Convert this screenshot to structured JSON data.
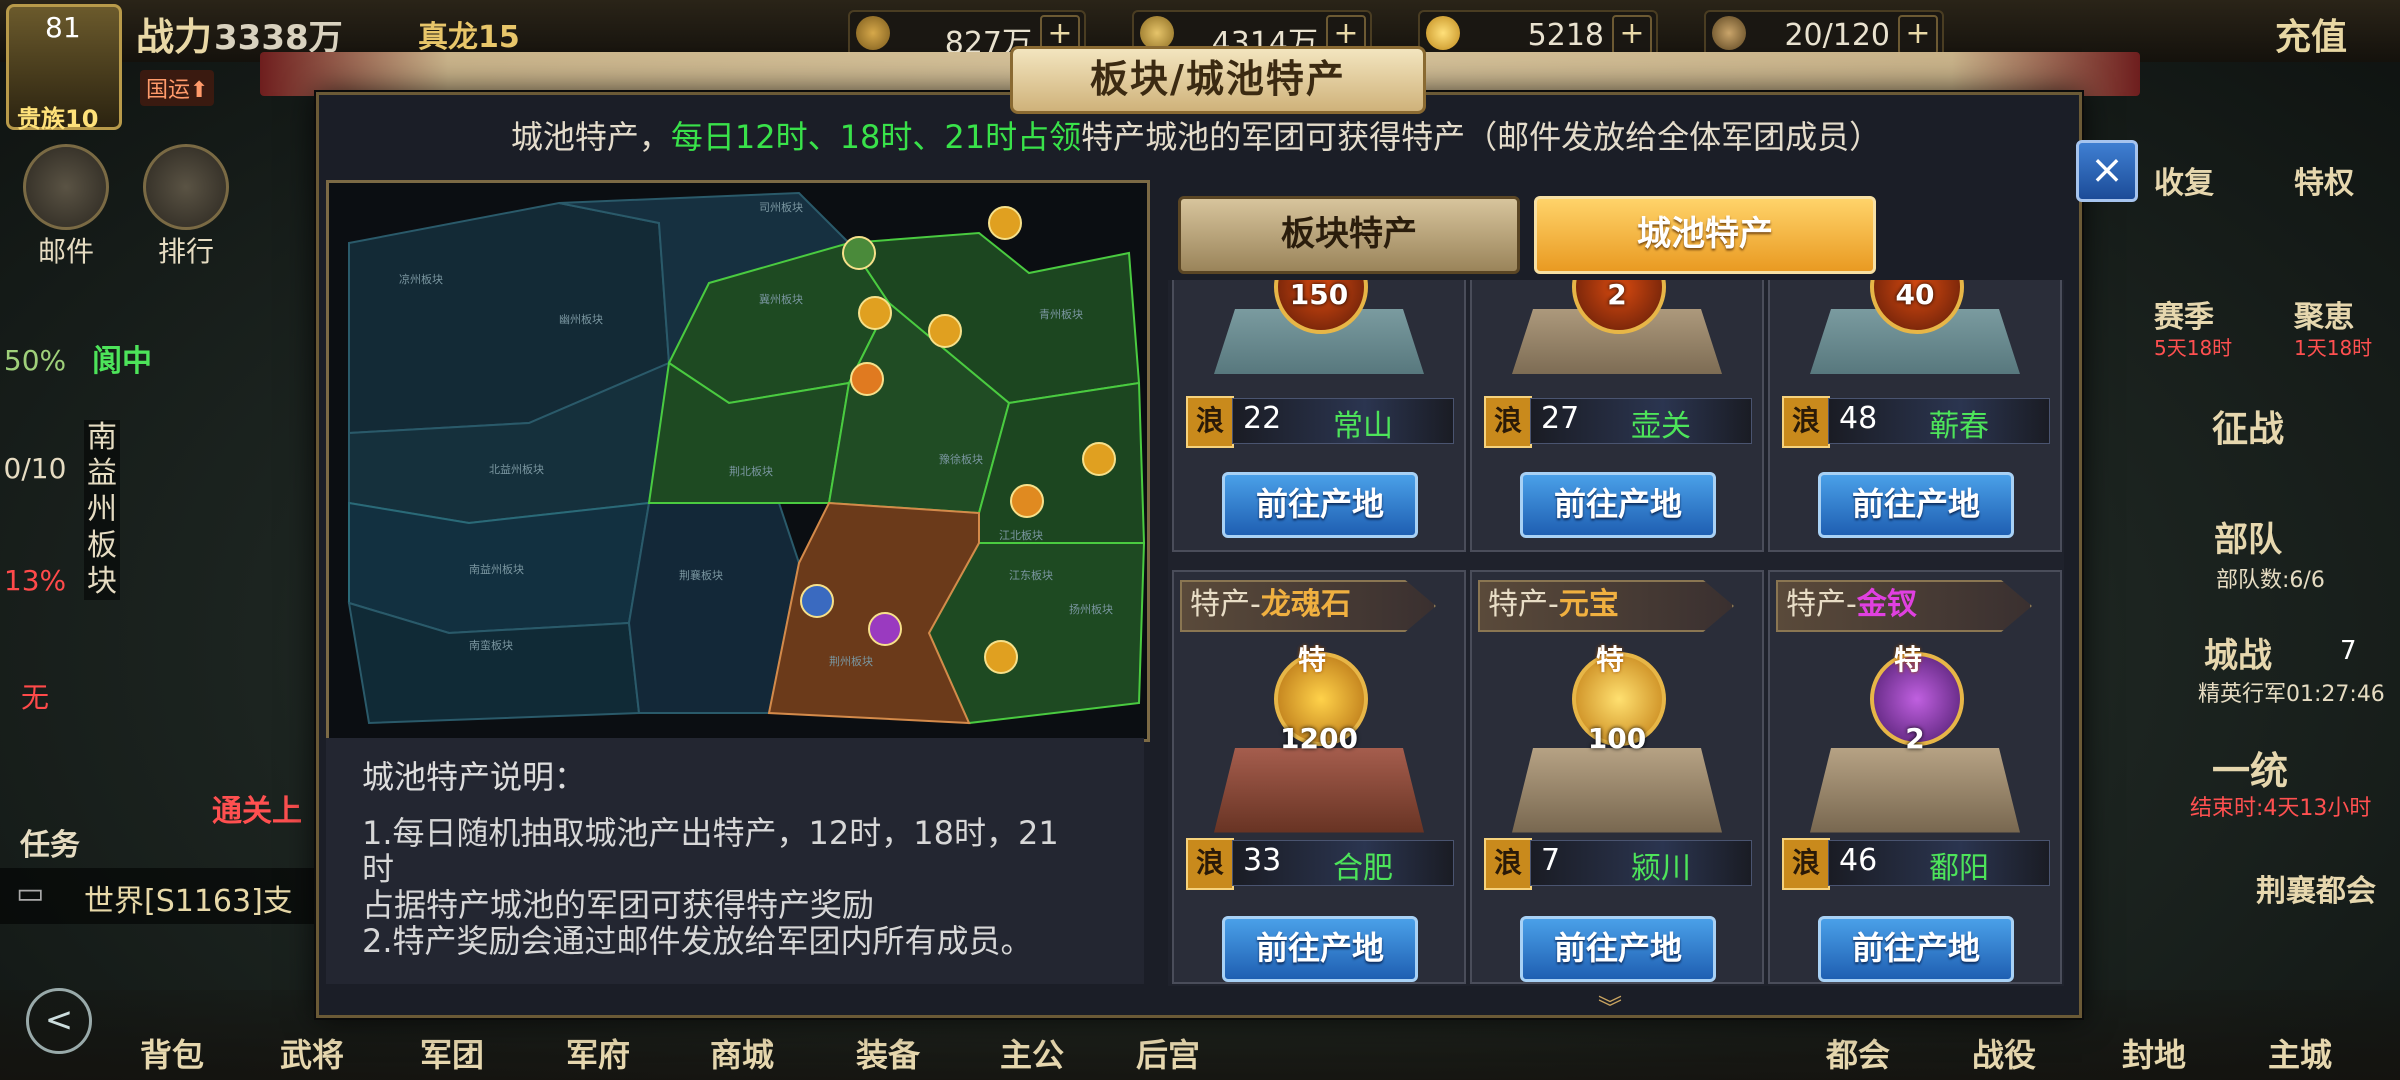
{
  "top": {
    "resources": [
      {
        "icon": "grain-icon",
        "value": "827万"
      },
      {
        "icon": "copper-coin-icon",
        "value": "4314万"
      },
      {
        "icon": "gold-ingot-icon",
        "value": "5218"
      },
      {
        "icon": "stamina-icon",
        "value": "20/120"
      }
    ],
    "plus": "+",
    "charge": "充值"
  },
  "player": {
    "level": "81",
    "vip": "贵族10",
    "power_label": "战力",
    "power": "3338万",
    "realm": "真龙15",
    "guoyun": "国运⬆"
  },
  "left_buttons": [
    {
      "label": "邮件",
      "icon": "mail-icon"
    },
    {
      "label": "排行",
      "icon": "ranking-icon"
    }
  ],
  "left_stats": [
    {
      "value": "50%",
      "color": "#9fd07a"
    },
    {
      "value": "0/10",
      "color": "#e6dcc2"
    },
    {
      "value": "13%",
      "color": "#ff4a4a"
    },
    {
      "value": "无",
      "color": "#ff4a4a"
    }
  ],
  "left_region": {
    "city": "阆中",
    "region": "南益州板块",
    "quest": "任务",
    "quest_text": "通关上"
  },
  "chat": {
    "channel": "世界",
    "text": "[S1163]支"
  },
  "right_buttons": [
    "收复",
    "特权",
    "赛季",
    "聚恵",
    "征战",
    "部队",
    "部队数:6/6",
    "城战",
    "7",
    "精英行军01:27:46",
    "一统",
    "结束时:4天13小时",
    "荆襄都会"
  ],
  "right_badges": {
    "season_timer": "5天18时",
    "juhui_timer": "1天18时"
  },
  "bottom": [
    "背包",
    "武将",
    "军团",
    "军府",
    "商城",
    "装备",
    "主公",
    "后宫",
    "都会",
    "战役",
    "封地",
    "主城"
  ],
  "modal": {
    "title": "板块/城池特产",
    "notice_pre": "城池特产，",
    "notice_green": "每日12时、18时、21时占领",
    "notice_post": "特产城池的军团可获得特产（邮件发放给全体军团成员）",
    "close": "×",
    "tabs": {
      "block": "板块特产",
      "city": "城池特产"
    },
    "desc": {
      "title": "城池特产说明：",
      "line1": "1.每日随机抽取城池产出特产，12时，18时，21",
      "line1b": "时",
      "line2": "占据特产城池的军团可获得特产奖励",
      "line3": "2.特产奖励会通过邮件发放给军团内所有成员。"
    },
    "map_regions": [
      "凉州板块",
      "司州板块",
      "幽州板块",
      "北益州板块",
      "冀州板块",
      "青州板块",
      "豫徐板块",
      "荆北板块",
      "南益州板块",
      "荆襄板块",
      "江北板块",
      "江东板块",
      "南蛮板块",
      "扬州板块",
      "荆州板块"
    ],
    "go_label": "前往产地",
    "lang": "浪",
    "te": "特",
    "special_prefix": "特产-",
    "cards": [
      {
        "amount": "150",
        "level": "22",
        "city": "常山",
        "special": "",
        "color": ""
      },
      {
        "amount": "2",
        "level": "27",
        "city": "壶关",
        "special": "",
        "color": ""
      },
      {
        "amount": "40",
        "level": "48",
        "city": "蕲春",
        "special": "",
        "color": ""
      },
      {
        "amount": "1200",
        "level": "33",
        "city": "合肥",
        "special": "龙魂石",
        "color": "#f0b040"
      },
      {
        "amount": "100",
        "level": "7",
        "city": "颍川",
        "special": "元宝",
        "color": "#f0b040"
      },
      {
        "amount": "2",
        "level": "46",
        "city": "鄱阳",
        "special": "金钗",
        "color": "#e040e0"
      }
    ]
  }
}
